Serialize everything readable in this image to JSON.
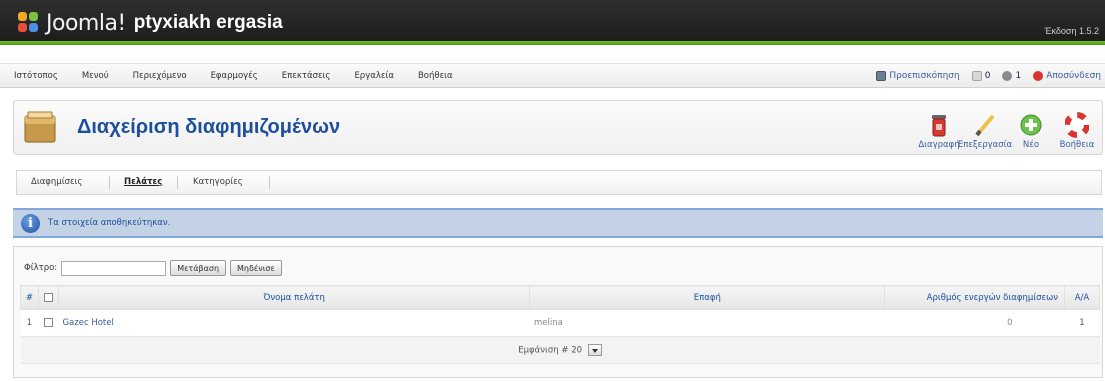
{
  "header": {
    "logo_text": "Joomla!",
    "site_name": "ptyxiakh ergasia",
    "version": "Έκδοση 1.5.2"
  },
  "menu": {
    "items": [
      "Ιστότοπος",
      "Μενού",
      "Περιεχόμενο",
      "Εφαρμογές",
      "Επεκτάσεις",
      "Εργαλεία",
      "Βοήθεια"
    ]
  },
  "status": {
    "preview": "Προεπισκόπηση",
    "messages": "0",
    "users": "1",
    "logout": "Αποσύνδεση"
  },
  "toolbar": {
    "title": "Διαχείριση διαφημιζομένων",
    "buttons": [
      "Διαγραφή",
      "Επεξεργασία",
      "Νέο",
      "Βοήθεια"
    ]
  },
  "submenu": {
    "tabs": [
      "Διαφημίσεις",
      "Πελάτες",
      "Κατηγορίες"
    ],
    "active": "Πελάτες"
  },
  "message": {
    "text": "Τα στοιχεία αποθηκεύτηκαν."
  },
  "filter": {
    "label": "Φίλτρο:",
    "value": "",
    "go_label": "Μετάβαση",
    "reset_label": "Μηδένισε"
  },
  "table": {
    "headers": {
      "num": "#",
      "name": "Όνομα πελάτη",
      "contact": "Επαφή",
      "active_banners": "Αριθμός ενεργών διαφημίσεων",
      "id": "A/A"
    },
    "rows": [
      {
        "num": "1",
        "name": "Gazec Hotel",
        "contact": "melina",
        "active_banners": "0",
        "id": "1"
      }
    ],
    "display_label": "Εμφάνιση #",
    "display_value": "20"
  },
  "colors": {
    "header_bg": "#1b1b1b",
    "green_accent": "#5aa81c",
    "title_blue": "#1c4f9c",
    "message_bg": "#c3d2e5"
  }
}
